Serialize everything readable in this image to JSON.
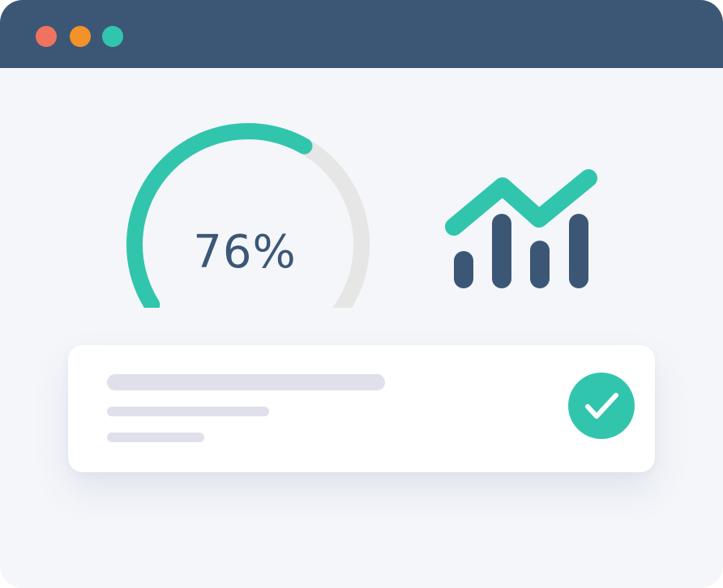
{
  "window": {
    "controls": [
      {
        "name": "close",
        "color": "#f0735f"
      },
      {
        "name": "minimize",
        "color": "#f4922a"
      },
      {
        "name": "maximize",
        "color": "#32c5ad"
      }
    ]
  },
  "gauge": {
    "label": "76%",
    "value": 0.76,
    "color": "#32c5ad",
    "track_color": "#e6e6e6",
    "text_color": "#3c5776"
  },
  "stats_icon": {
    "icon": "bar-chart-trend-icon",
    "bar_levels": [
      0.25,
      0.5,
      0.32,
      0.5
    ],
    "bar_color": "#3c5776",
    "line_color": "#32c5ad"
  },
  "result_card": {
    "status_icon": "check-circle-icon",
    "status_color": "#32c5ad",
    "placeholder_color": "#dfe0ec"
  }
}
